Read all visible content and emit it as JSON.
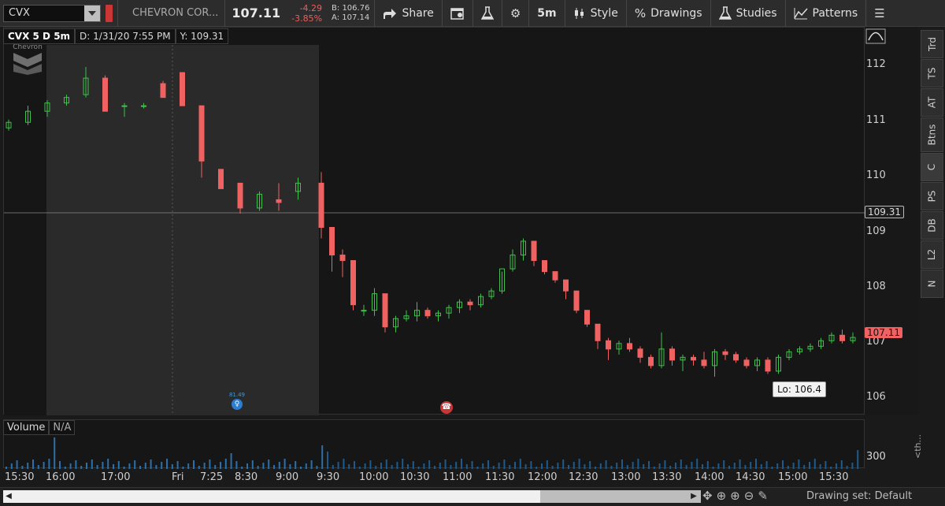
{
  "toolbar": {
    "symbol": "CVX",
    "company": "CHEVRON COR...",
    "last": "107.11",
    "change": "-4.29",
    "change_pct": "-3.85%",
    "bid": "B: 106.76",
    "ask": "A: 107.14",
    "share": "Share",
    "interval": "5m",
    "style": "Style",
    "drawings": "Drawings",
    "studies": "Studies",
    "patterns": "Patterns"
  },
  "chart_header": {
    "title": "CVX 5 D 5m",
    "date": "D: 1/31/20 7:55 PM",
    "y": "Y: 109.31"
  },
  "side_tabs": [
    "Trd",
    "TS",
    "AT",
    "Btns",
    "C",
    "PS",
    "DB",
    "L2",
    "N"
  ],
  "logo_text": "Chevron",
  "yaxis": {
    "ticks": [
      "112",
      "111",
      "110",
      "109",
      "108",
      "107",
      "106"
    ],
    "crosshair_label": "109.31",
    "last_label": "107.11"
  },
  "low_label": "Lo: 106.4",
  "event_label": "81.49",
  "volume": {
    "title": "Volume",
    "value": "N/A",
    "tick": "300",
    "side": "<th..."
  },
  "xaxis": {
    "ticks": [
      "15:30",
      "16:00",
      "17:00",
      "Fri",
      "7:25",
      "8:30",
      "9:00",
      "9:30",
      "10:00",
      "10:30",
      "11:00",
      "11:30",
      "12:00",
      "12:30",
      "13:00",
      "13:30",
      "14:00",
      "14:30",
      "15:00",
      "15:30"
    ]
  },
  "bottom": {
    "drawing_set": "Drawing set: Default"
  },
  "colors": {
    "up": "#3fc24a",
    "down": "#f06262",
    "accent_blue": "#2a7fd4",
    "bg": "#161616"
  },
  "chart_data": {
    "type": "candlestick",
    "interval": "5m",
    "ylim": [
      105.7,
      112.4
    ],
    "crosshair_y": 109.31,
    "last": 107.11,
    "low": 106.4,
    "candles_summary": {
      "premarket": [
        [
          110.9,
          111.05,
          110.85,
          111.0
        ],
        [
          111.0,
          111.3,
          110.95,
          111.2
        ],
        [
          111.2,
          111.4,
          111.1,
          111.35
        ],
        [
          111.35,
          111.5,
          111.3,
          111.45
        ],
        [
          111.5,
          112.0,
          111.45,
          111.8
        ],
        [
          111.8,
          111.85,
          111.2,
          111.2
        ],
        [
          111.3,
          111.35,
          111.1,
          111.3
        ],
        [
          111.3,
          111.35,
          111.25,
          111.3
        ],
        [
          111.7,
          111.75,
          111.45,
          111.45
        ],
        [
          111.9,
          111.9,
          111.3,
          111.3
        ],
        [
          111.3,
          111.3,
          110.0,
          110.3
        ],
        [
          110.15,
          110.15,
          109.8,
          109.8
        ],
        [
          109.9,
          109.9,
          109.35,
          109.45
        ],
        [
          109.45,
          109.75,
          109.4,
          109.7
        ],
        [
          109.6,
          109.9,
          109.4,
          109.55
        ],
        [
          109.75,
          110.0,
          109.6,
          109.9
        ]
      ],
      "session": [
        [
          109.9,
          110.1,
          108.9,
          109.1
        ],
        [
          109.1,
          109.1,
          108.3,
          108.6
        ],
        [
          108.6,
          108.7,
          108.2,
          108.5
        ],
        [
          108.5,
          108.5,
          107.6,
          107.7
        ],
        [
          107.6,
          107.7,
          107.5,
          107.6
        ],
        [
          107.6,
          108.0,
          107.5,
          107.9
        ],
        [
          107.9,
          107.9,
          107.2,
          107.3
        ],
        [
          107.3,
          107.5,
          107.2,
          107.45
        ],
        [
          107.45,
          107.6,
          107.4,
          107.5
        ],
        [
          107.5,
          107.75,
          107.4,
          107.6
        ],
        [
          107.6,
          107.65,
          107.45,
          107.5
        ],
        [
          107.5,
          107.6,
          107.4,
          107.55
        ],
        [
          107.55,
          107.7,
          107.45,
          107.65
        ],
        [
          107.65,
          107.8,
          107.55,
          107.75
        ],
        [
          107.75,
          107.8,
          107.6,
          107.7
        ],
        [
          107.7,
          107.9,
          107.65,
          107.85
        ],
        [
          107.85,
          108.0,
          107.8,
          107.95
        ],
        [
          107.95,
          108.3,
          107.9,
          108.35
        ],
        [
          108.35,
          108.7,
          108.3,
          108.6
        ],
        [
          108.6,
          108.9,
          108.5,
          108.85
        ],
        [
          108.85,
          108.85,
          108.4,
          108.5
        ],
        [
          108.5,
          108.5,
          108.25,
          108.3
        ],
        [
          108.3,
          108.3,
          108.1,
          108.15
        ],
        [
          108.15,
          108.15,
          107.8,
          107.95
        ],
        [
          107.95,
          107.95,
          107.55,
          107.6
        ],
        [
          107.6,
          107.6,
          107.3,
          107.35
        ],
        [
          107.35,
          107.35,
          106.9,
          107.05
        ],
        [
          107.05,
          107.1,
          106.7,
          106.9
        ],
        [
          106.9,
          107.05,
          106.8,
          107.0
        ],
        [
          107.0,
          107.1,
          106.85,
          106.9
        ],
        [
          106.9,
          106.95,
          106.65,
          106.75
        ],
        [
          106.75,
          106.8,
          106.55,
          106.6
        ],
        [
          106.6,
          107.2,
          106.55,
          106.9
        ],
        [
          106.9,
          106.95,
          106.6,
          106.7
        ],
        [
          106.7,
          106.8,
          106.5,
          106.75
        ],
        [
          106.75,
          106.8,
          106.6,
          106.7
        ],
        [
          106.7,
          106.85,
          106.55,
          106.6
        ],
        [
          106.6,
          106.9,
          106.4,
          106.85
        ],
        [
          106.85,
          106.9,
          106.7,
          106.8
        ],
        [
          106.8,
          106.85,
          106.65,
          106.7
        ],
        [
          106.7,
          106.75,
          106.55,
          106.6
        ],
        [
          106.6,
          106.75,
          106.5,
          106.7
        ],
        [
          106.7,
          106.75,
          106.45,
          106.5
        ],
        [
          106.5,
          106.8,
          106.45,
          106.75
        ],
        [
          106.75,
          106.9,
          106.7,
          106.85
        ],
        [
          106.85,
          106.95,
          106.8,
          106.9
        ],
        [
          106.9,
          107.0,
          106.85,
          106.95
        ],
        [
          106.95,
          107.1,
          106.9,
          107.05
        ],
        [
          107.05,
          107.2,
          107.0,
          107.15
        ],
        [
          107.15,
          107.25,
          107.0,
          107.05
        ],
        [
          107.05,
          107.2,
          107.0,
          107.11
        ]
      ]
    },
    "volume_scale_max": 300
  }
}
